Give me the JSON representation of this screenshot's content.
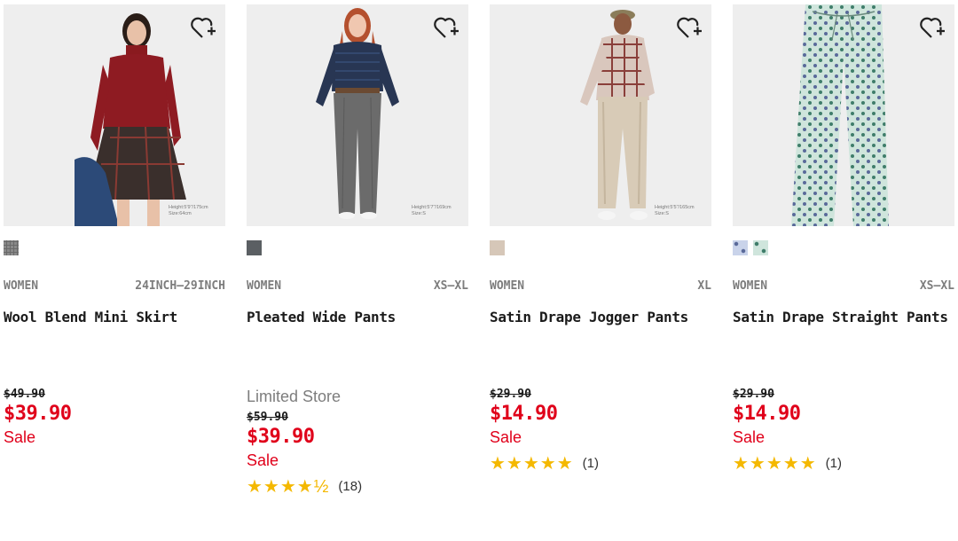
{
  "products": [
    {
      "photo_note": [
        "Height:5'9\"/175cm",
        "Size:64cm"
      ],
      "category": "WOMEN",
      "size_range": "24INCH–29INCH",
      "name": "Wool Blend Mini Skirt",
      "store": "",
      "original_price": "$49.90",
      "sale_price": "$39.90",
      "sale_label": "Sale",
      "rating_stars": "",
      "rating_count": "",
      "swatch_colors": [
        "#8a8a8a"
      ]
    },
    {
      "photo_note": [
        "Height:5'7\"/169cm",
        "Size:S"
      ],
      "category": "WOMEN",
      "size_range": "XS–XL",
      "name": "Pleated Wide Pants",
      "store": "Limited Store",
      "original_price": "$59.90",
      "sale_price": "$39.90",
      "sale_label": "Sale",
      "rating_stars": "★★★★½",
      "rating_count": "(18)",
      "swatch_colors": [
        "#5b5f63"
      ]
    },
    {
      "photo_note": [
        "Height:5'5\"/165cm",
        "Size:S"
      ],
      "category": "WOMEN",
      "size_range": "XL",
      "name": "Satin Drape Jogger Pants",
      "store": "",
      "original_price": "$29.90",
      "sale_price": "$14.90",
      "sale_label": "Sale",
      "rating_stars": "★★★★★",
      "rating_count": "(1)",
      "swatch_colors": [
        "#d6c7b8"
      ]
    },
    {
      "photo_note": [],
      "category": "WOMEN",
      "size_range": "XS–XL",
      "name": "Satin Drape Straight Pants",
      "store": "",
      "original_price": "$29.90",
      "sale_price": "$14.90",
      "sale_label": "Sale",
      "rating_stars": "★★★★★",
      "rating_count": "(1)",
      "swatch_colors": [
        "#5a6a9a",
        "#7fb9a6"
      ]
    }
  ],
  "colors": {
    "sale_red": "#e0001a",
    "star_yellow": "#f4b800"
  },
  "icons": {
    "favorite": "heart-plus-icon"
  }
}
